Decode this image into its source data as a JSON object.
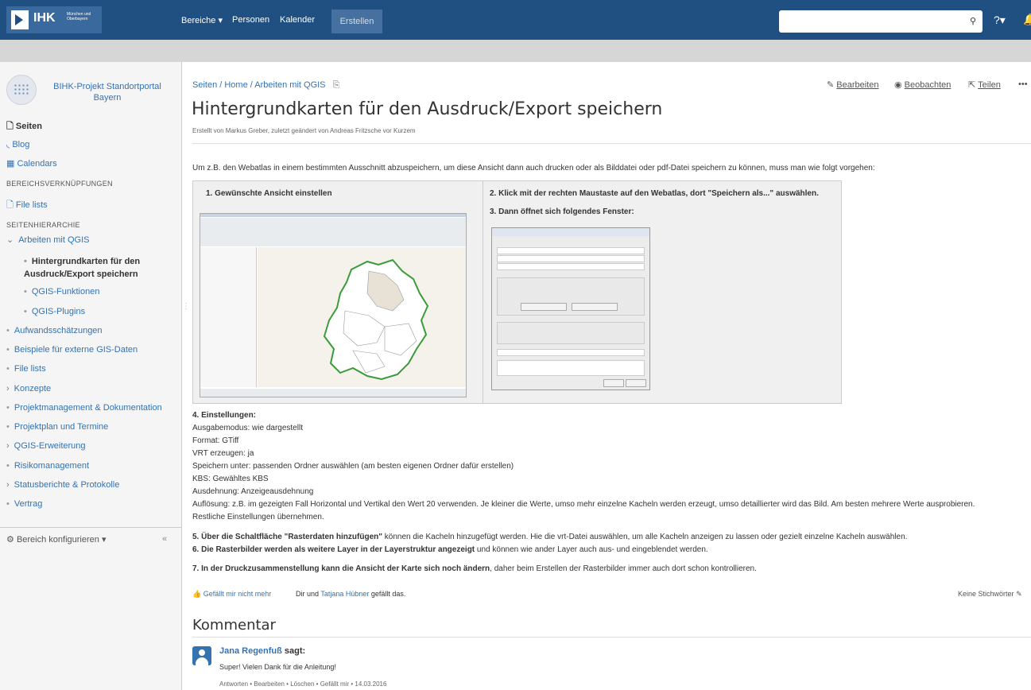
{
  "nav": {
    "logo_text": "IHK",
    "logo_sub": "München und Oberbayern",
    "items": [
      "Bereiche ▾",
      "Personen",
      "Kalender"
    ],
    "create": "Erstellen",
    "search_placeholder": "",
    "help": "?▾"
  },
  "sidebar": {
    "space_name": "BIHK-Projekt Standortportal Bayern",
    "links": [
      "Seiten",
      "Blog",
      "Calendars"
    ],
    "head_links": "BEREICHSVERKNÜPFUNGEN",
    "file_lists": "File lists",
    "head_tree": "SEITENHIERARCHIE",
    "tree": {
      "parent": "Arbeiten mit QGIS",
      "current": "Hintergrundkarten für den Ausdruck/Export speichern",
      "children": [
        "QGIS-Funktionen",
        "QGIS-Plugins"
      ],
      "siblings": [
        "Aufwandsschätzungen",
        "Beispiele für externe GIS-Daten",
        "File lists",
        "Konzepte",
        "Projektmanagement & Dokumentation",
        "Projektplan und Termine",
        "QGIS-Erweiterung",
        "Risikomanagement",
        "Statusberichte & Protokolle",
        "Vertrag"
      ]
    },
    "configure": "Bereich konfigurieren ▾",
    "collapse": "«"
  },
  "page": {
    "breadcrumb": "Seiten / Home / Arbeiten mit QGIS",
    "actions": [
      "Bearbeiten",
      "Beobachten",
      "Teilen",
      "•••"
    ],
    "title": "Hintergrundkarten für den Ausdruck/Export speichern",
    "byline": "Erstellt von Markus Greber, zuletzt geändert von Andreas Fritzsche vor Kurzem",
    "intro": "Um z.B. den Webatlas in einem bestimmten Ausschnitt abzuspeichern, um diese Ansicht dann auch drucken oder als Bilddatei oder pdf-Datei speichern zu können, muss man wie folgt vorgehen:",
    "step1": "1. Gewünschte Ansicht einstellen",
    "step2": "2. Klick mit der rechten Maustaste auf den Webatlas, dort \"Speichern als...\" auswählen.",
    "step3": "3. Dann öffnet sich folgendes Fenster:",
    "settings_head": "4. Einstellungen:",
    "settings": [
      "Ausgabemodus: wie dargestellt",
      "Format: GTiff",
      "VRT erzeugen: ja",
      "Speichern unter: passenden Ordner auswählen (am besten eigenen Ordner dafür erstellen)",
      "KBS: Gewähltes KBS",
      "Ausdehnung: Anzeigeausdehnung",
      "Auflösung: z.B. im gezeigten Fall Horizontal und Vertikal den Wert 20 verwenden. Je kleiner die Werte, umso mehr einzelne Kacheln werden erzeugt, umso detaillierter wird das Bild. Am besten mehrere Werte ausprobieren.",
      "Restliche Einstellungen übernehmen."
    ],
    "step5_bold": "5. Über die Schaltfläche \"Rasterdaten hinzufügen\"",
    "step5_rest": " können die Kacheln hinzugefügt werden. Hie die vrt-Datei auswählen, um alle Kacheln anzeigen zu lassen oder gezielt einzelne Kacheln auswählen.",
    "step6_bold": "6. Die Rasterbilder werden als weitere Layer in der Layerstruktur angezeigt",
    "step6_rest": " und können wie ander Layer auch aus- und eingeblendet werden.",
    "step7_bold": "7. In der Druckzusammenstellung kann die Ansicht der Karte sich noch ändern",
    "step7_rest": ", daher beim Erstellen der Rasterbilder immer auch dort schon kontrollieren.",
    "like_link": "Gefällt mir nicht mehr",
    "like_prefix": "Dir und ",
    "like_name": "Tatjana Hübner",
    "like_suffix": " gefällt das.",
    "labels": "Keine Stichwörter"
  },
  "comments": {
    "heading": "Kommentar",
    "author": "Jana Regenfuß",
    "says": " sagt:",
    "text": "Super! Vielen Dank für die Anleitung!",
    "actions": "Antworten • Bearbeiten • Löschen • Gefällt mir • 14.03.2016"
  }
}
